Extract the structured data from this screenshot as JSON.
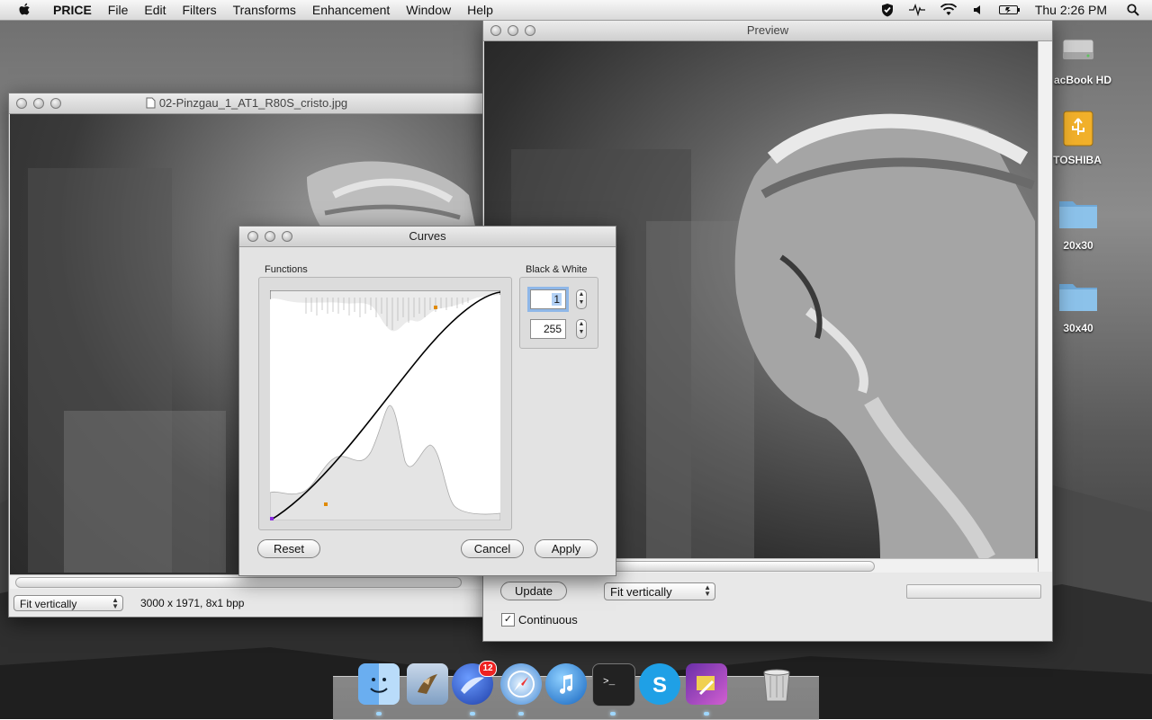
{
  "menubar": {
    "app_name": "PRICE",
    "items": [
      "File",
      "Edit",
      "Filters",
      "Transforms",
      "Enhancement",
      "Window",
      "Help"
    ],
    "clock": "Thu 2:26 PM",
    "status_icons": [
      "lock-icon",
      "activity-icon",
      "wifi-icon",
      "volume-icon",
      "battery-icon",
      "spotlight-icon"
    ]
  },
  "image_window": {
    "title": "02-Pinzgau_1_AT1_R80S_cristo.jpg",
    "zoom_select": "Fit vertically",
    "info": "3000 x 1971, 8x1 bpp"
  },
  "preview_window": {
    "title": "Preview",
    "update_label": "Update",
    "zoom_select": "Fit vertically",
    "continuous_label": "Continuous",
    "continuous_checked": true
  },
  "curves_dialog": {
    "title": "Curves",
    "functions_label": "Functions",
    "bw_label": "Black & White",
    "black_value": "1",
    "white_value": "255",
    "reset_label": "Reset",
    "cancel_label": "Cancel",
    "apply_label": "Apply"
  },
  "desktop_items": [
    {
      "label": "acBook HD",
      "icon": "hard-drive-icon"
    },
    {
      "label": "TOSHIBA",
      "icon": "usb-drive-icon"
    },
    {
      "label": "20x30",
      "icon": "folder-icon"
    },
    {
      "label": "30x40",
      "icon": "folder-icon"
    }
  ],
  "dock": {
    "apps": [
      "finder-icon",
      "mail-icon",
      "safari-icon",
      "sailfish-icon",
      "itunes-icon",
      "terminal-icon",
      "skype-icon",
      "price-icon",
      "trash-icon"
    ],
    "mail_badge": "12"
  },
  "colors": {
    "accent_orange": "#e08a00",
    "curve_black": "#000000",
    "selection_blue": "#8fb7e8"
  }
}
